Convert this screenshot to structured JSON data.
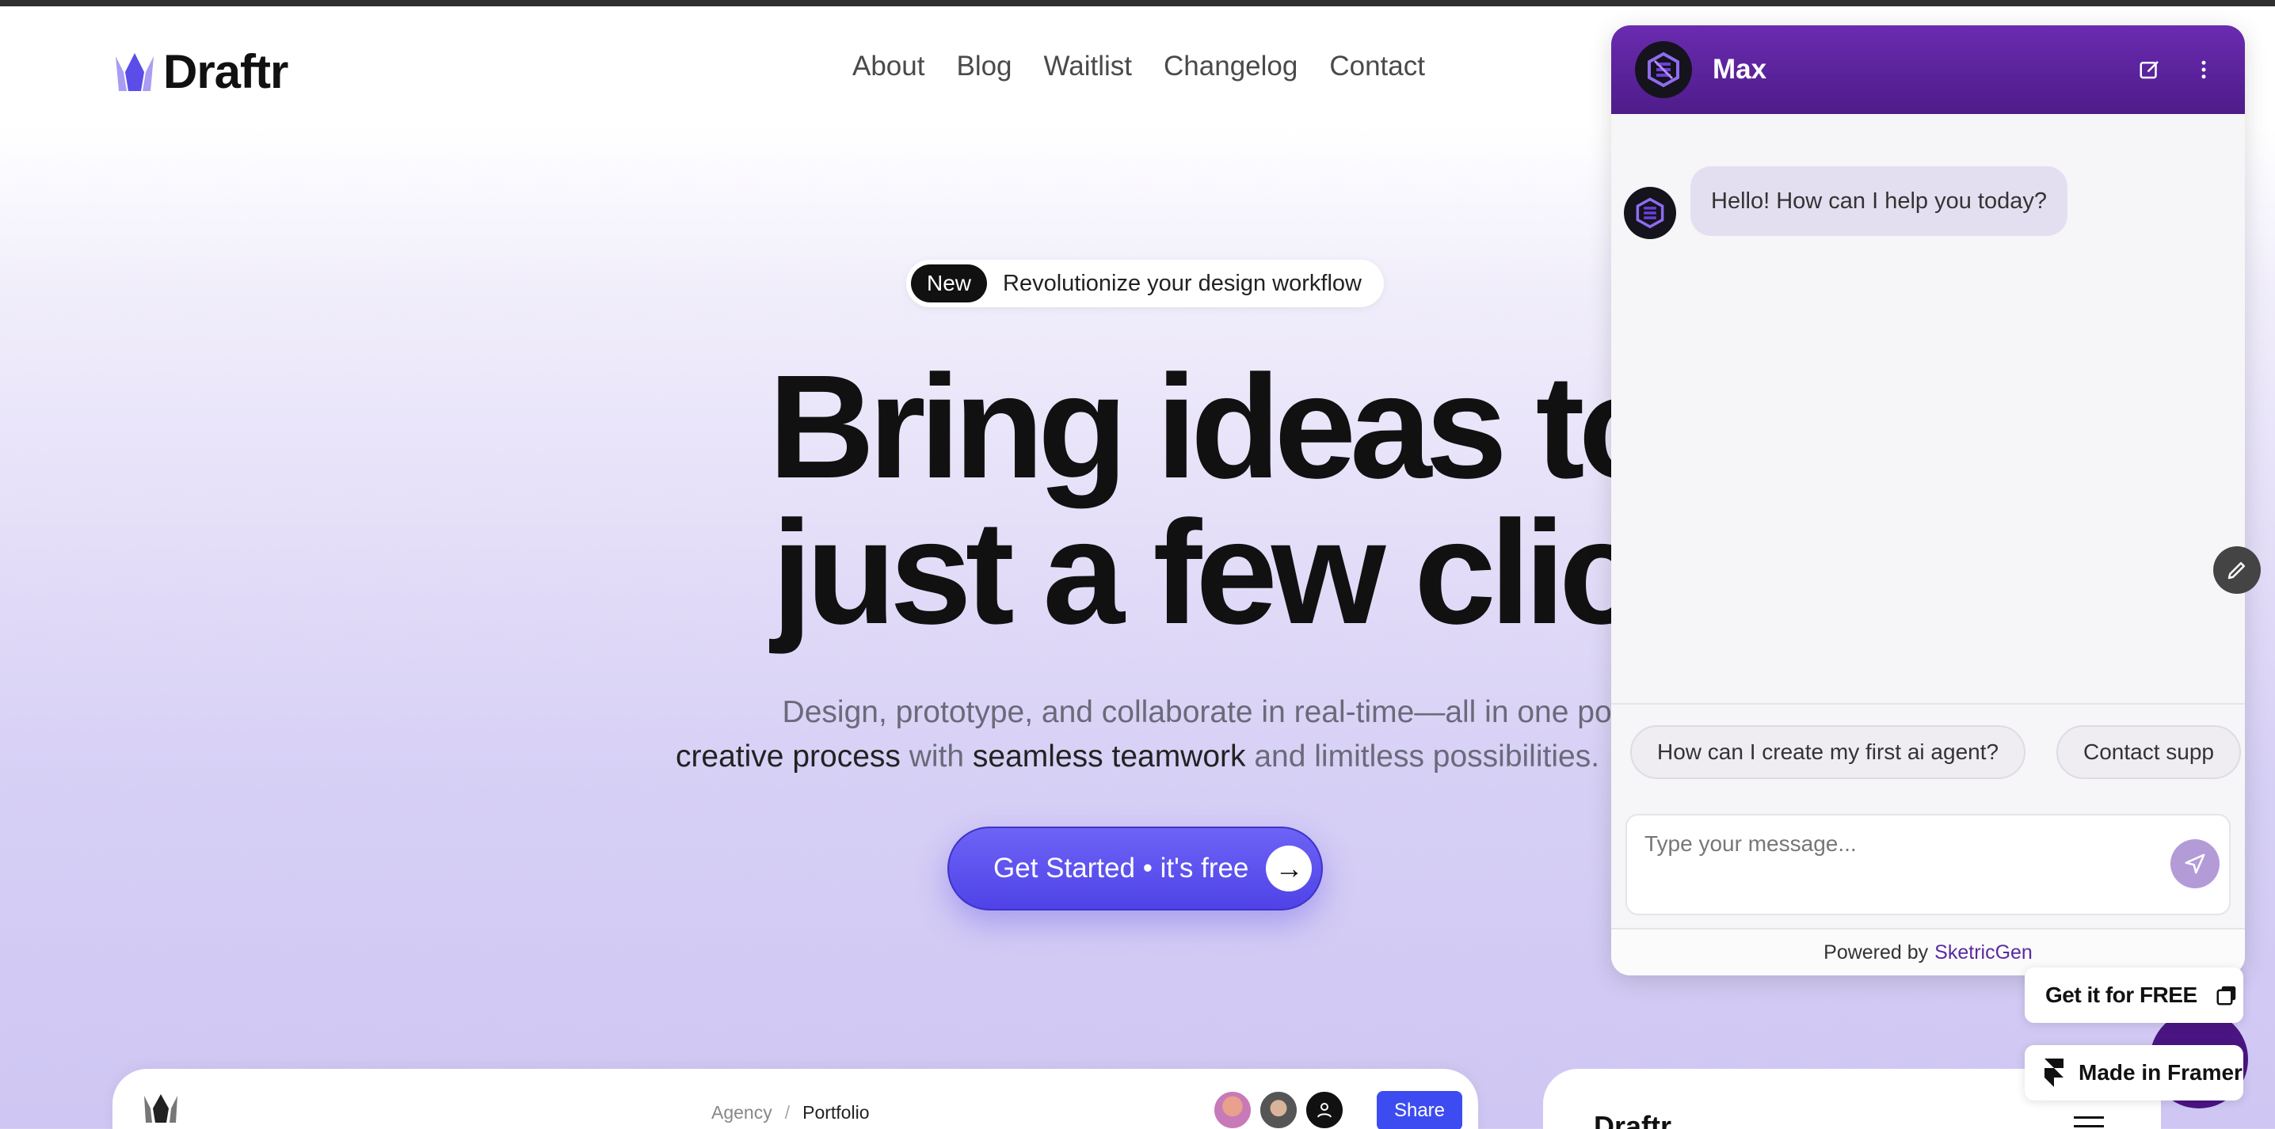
{
  "brand": {
    "name": "Draftr"
  },
  "nav": {
    "items": [
      "About",
      "Blog",
      "Waitlist",
      "Changelog",
      "Contact"
    ]
  },
  "hero": {
    "badge": "New",
    "badge_text": "Revolutionize your design workflow",
    "headline_line1": "Bring ideas to life i",
    "headline_line2": "just a few clicks.",
    "sub_line1": "Design, prototype, and collaborate in real-time—all in one powerful platform. Ele",
    "sub_line2_a": "creative process",
    "sub_line2_b": " with ",
    "sub_line2_c": "seamless teamwork",
    "sub_line2_d": " and limitless possibilities.",
    "cta_label": "Get Started • it's free"
  },
  "preview": {
    "breadcrumb": [
      "Agency",
      "Portfolio"
    ],
    "breadcrumb_sep": "/",
    "share_label": "Share",
    "right_brand": "Draftr"
  },
  "chat": {
    "agent_name": "Max",
    "greeting": "Hello! How can I help you today?",
    "suggestions": [
      "How can I create my first ai agent?",
      "Contact supp"
    ],
    "input_placeholder": "Type your message...",
    "powered_prefix": "Powered by",
    "powered_brand": "SketricGen"
  },
  "floating": {
    "get_free_label": "Get it for FREE",
    "framer_label": "Made in Framer"
  },
  "colors": {
    "accent": "#5146ea",
    "chat_header": "#5b2399",
    "share": "#3d4cf0"
  }
}
